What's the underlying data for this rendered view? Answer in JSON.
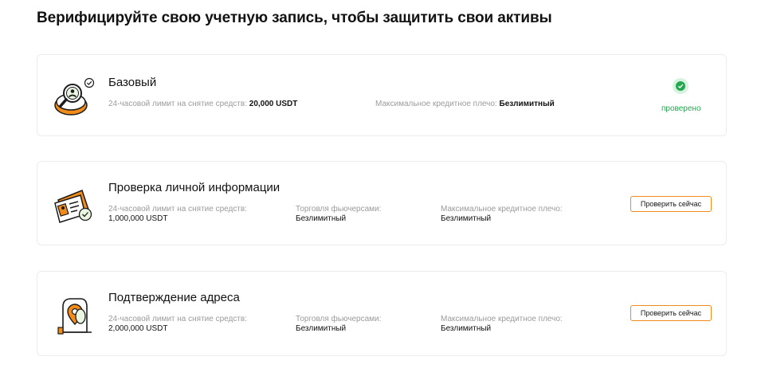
{
  "page": {
    "title": "Верифицируйте свою учетную запись, чтобы защитить свои активы"
  },
  "levels": [
    {
      "title": "Базовый",
      "withdraw_label": "24-часовой лимит на снятие средств:",
      "withdraw_value": "20,000 USDT",
      "leverage_label": "Максимальное кредитное плечо:",
      "leverage_value": "Безлимитный",
      "status": "проверено",
      "icon": "magnifier-user-icon"
    },
    {
      "title": "Проверка личной информации",
      "withdraw_label": "24-часовой лимит на снятие средств:",
      "withdraw_value": "1,000,000 USDT",
      "futures_label": "Торговля фьючерсами:",
      "futures_value": "Безлимитный",
      "leverage_label": "Максимальное кредитное плечо:",
      "leverage_value": "Безлимитный",
      "button": "Проверить сейчас",
      "icon": "id-card-icon"
    },
    {
      "title": "Подтверждение адреса",
      "withdraw_label": "24-часовой лимит на снятие средств:",
      "withdraw_value": "2,000,000 USDT",
      "futures_label": "Торговля фьючерсами:",
      "futures_value": "Безлимитный",
      "leverage_label": "Максимальное кредитное плечо:",
      "leverage_value": "Безлимитный",
      "button": "Проверить сейчас",
      "icon": "location-document-icon"
    }
  ],
  "colors": {
    "accent": "#f18b1a",
    "success": "#25a750",
    "muted_text": "#9b9b9b",
    "text": "#121212"
  }
}
